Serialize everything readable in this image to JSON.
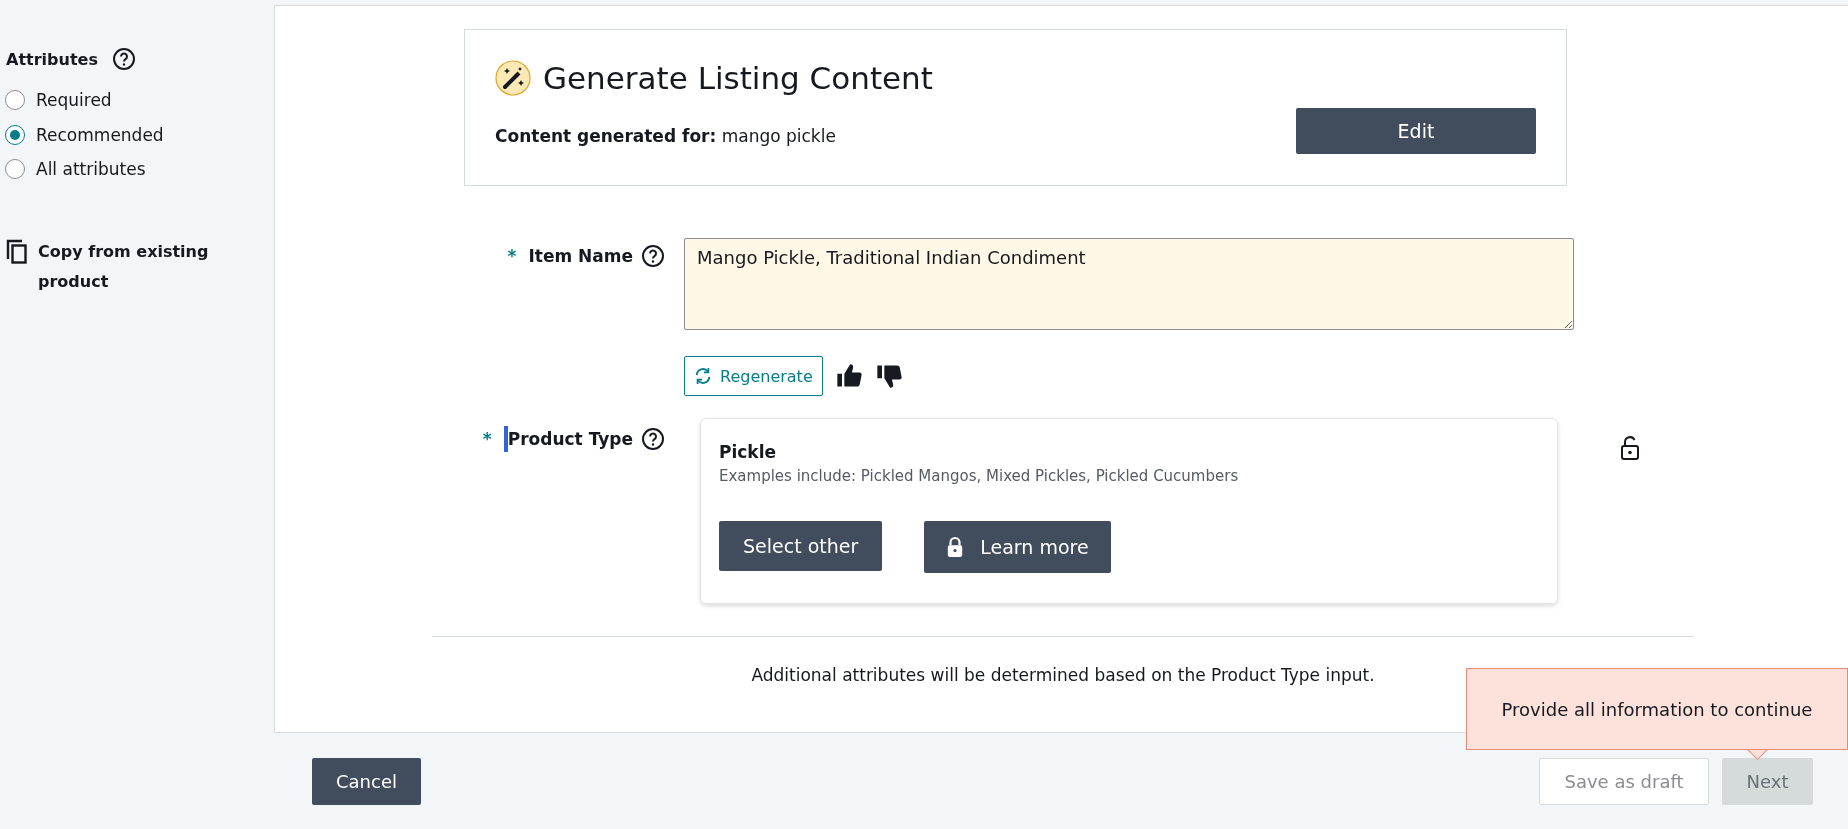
{
  "sidebar": {
    "title": "Attributes",
    "options": [
      {
        "label": "Required",
        "selected": false
      },
      {
        "label": "Recommended",
        "selected": true
      },
      {
        "label": "All attributes",
        "selected": false
      }
    ],
    "copy_link": "Copy from existing product"
  },
  "header": {
    "title": "Generate Listing Content",
    "subtitle_label": "Content generated for:",
    "subtitle_value": "mango pickle",
    "edit_button": "Edit"
  },
  "item_name": {
    "label": "Item Name",
    "required_mark": "*",
    "value": "Mango Pickle, Traditional Indian Condiment",
    "regenerate_button": "Regenerate"
  },
  "product_type": {
    "label": "Product Type",
    "required_mark": "*",
    "focused": true,
    "name": "Pickle",
    "examples": "Examples include: Pickled Mangos, Mixed Pickles, Pickled Cucumbers",
    "select_button": "Select other",
    "learn_button": "Learn more"
  },
  "note": "Additional attributes will be determined based on the Product Type input.",
  "footer": {
    "cancel": "Cancel",
    "buttons": [
      {
        "label": "Save as draft",
        "kind": "secondary",
        "disabled": true
      },
      {
        "label": "Next",
        "kind": "primary",
        "disabled": true
      }
    ],
    "tooltip": "Provide all information to continue"
  }
}
